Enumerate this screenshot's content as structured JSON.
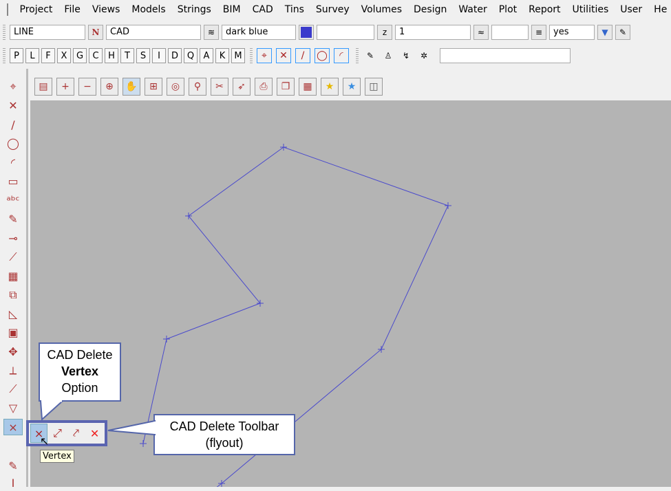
{
  "menu": [
    "Project",
    "File",
    "Views",
    "Models",
    "Strings",
    "BIM",
    "CAD",
    "Tins",
    "Survey",
    "Volumes",
    "Design",
    "Water",
    "Plot",
    "Report",
    "Utilities",
    "User",
    "He"
  ],
  "toolbar1": {
    "string_type": "LINE",
    "model": "CAD",
    "colour": "dark blue",
    "colour_hex": "#3b3bcc",
    "field_empty": "",
    "z_value": "1",
    "field_empty2": "",
    "linestyle": "yes"
  },
  "letter_buttons": [
    "P",
    "L",
    "F",
    "X",
    "G",
    "C",
    "H",
    "T",
    "S",
    "I",
    "D",
    "Q",
    "A",
    "K",
    "M"
  ],
  "callouts": {
    "vertex_option": {
      "line1": "CAD Delete",
      "line2": "Vertex",
      "line3": "Option"
    },
    "toolbar": {
      "line1": "CAD Delete Toolbar",
      "line2": "(flyout)"
    }
  },
  "tooltip": "Vertex",
  "line_color": "#4a4acc"
}
